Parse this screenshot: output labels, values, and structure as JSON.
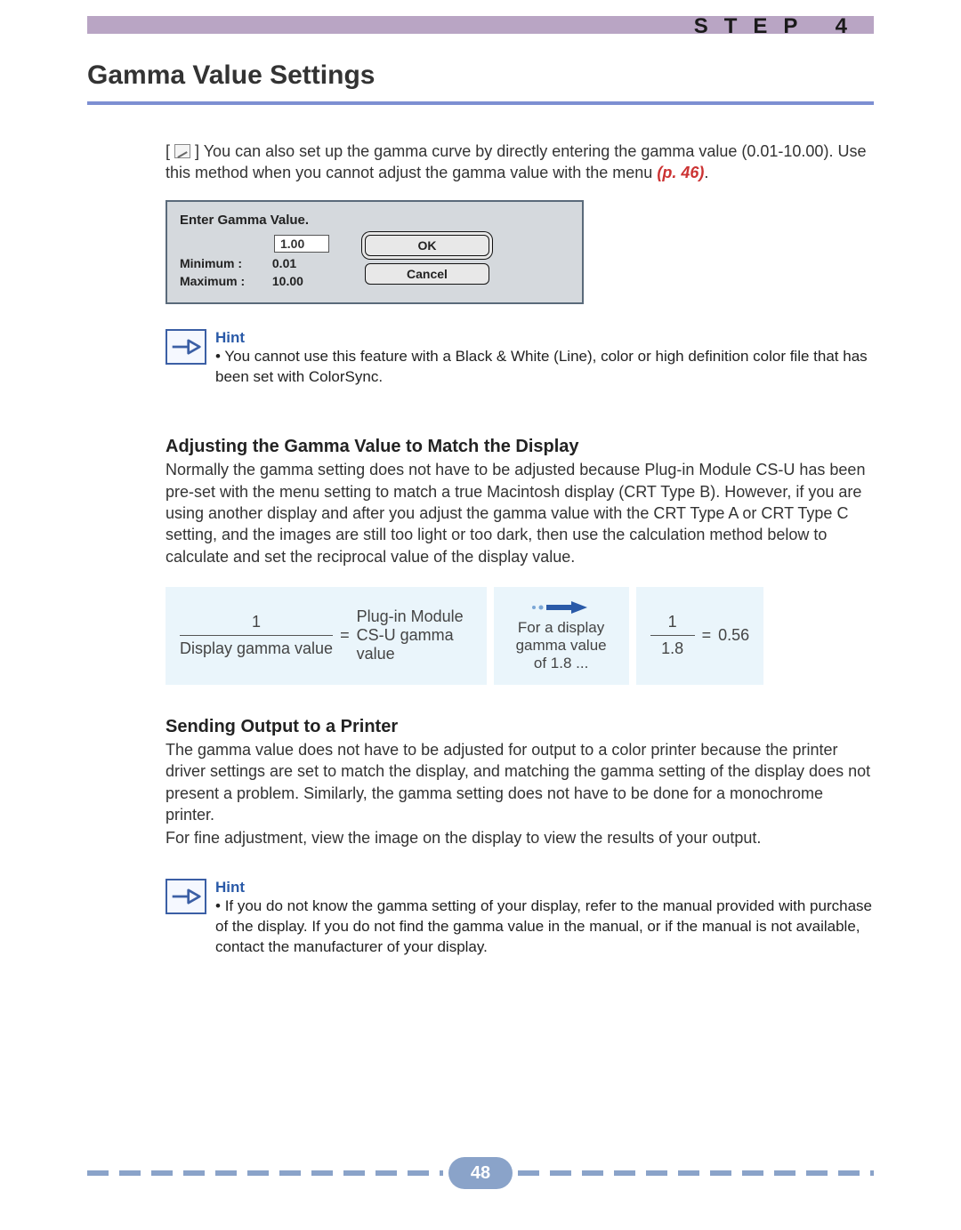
{
  "header": {
    "step_label": "STEP 4",
    "page_title": "Gamma Value Settings"
  },
  "intro": {
    "text_before_ref": "] You can also set up the gamma curve by directly entering the gamma value (0.01-10.00). Use this method when you cannot adjust the gamma value with the menu ",
    "ref": "(p. 46)",
    "period": "."
  },
  "dialog": {
    "title": "Enter Gamma Value.",
    "input_value": "1.00",
    "min_label": "Minimum :",
    "min_value": "0.01",
    "max_label": "Maximum :",
    "max_value": "10.00",
    "ok": "OK",
    "cancel": "Cancel"
  },
  "hint1": {
    "title": "Hint",
    "text": "You cannot use this feature with a Black & White (Line), color or high definition color file that has been set with ColorSync."
  },
  "section_adjust": {
    "heading": "Adjusting the Gamma Value to Match the Display",
    "body": "Normally the gamma setting does not have to be adjusted because Plug-in Module CS-U has been pre-set with the menu setting to match a true Macintosh display (CRT Type B).  However, if you are using another display and after you adjust the gamma value with the CRT Type A or CRT Type C setting, and the images are still too light or too dark, then use the calculation method below to calculate and set the reciprocal value of the display value."
  },
  "formula": {
    "left_top": "1",
    "left_bot": "Display gamma value",
    "eq1": "=",
    "mid": "Plug-in Module CS-U gamma value",
    "arrow_caption": "For a display gamma value of 1.8 ...",
    "right_top": "1",
    "right_bot": "1.8",
    "eq2": "=",
    "result": "0.56"
  },
  "section_printer": {
    "heading": "Sending Output to a Printer",
    "body1": "The gamma value does not have to be adjusted for output to a color printer because the printer driver settings are set to match the display, and matching the gamma setting of the display does not present a problem.  Similarly, the gamma setting does not have to be done for a monochrome printer.",
    "body2": "For fine adjustment, view the image on the display to view the results of your output."
  },
  "hint2": {
    "title": "Hint",
    "text": "If you do not know the gamma setting of your display, refer to the manual provided with purchase of the display.  If you do not find the gamma value in the manual, or if the manual is not available, contact the manufacturer of your display."
  },
  "footer": {
    "page_number": "48"
  }
}
